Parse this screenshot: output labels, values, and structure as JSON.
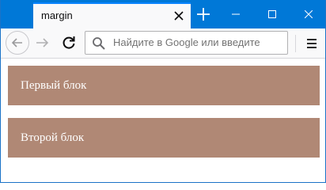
{
  "browser": {
    "tab_title": "margin",
    "url_placeholder": "Найдите в Google или введите",
    "accent_color": "#0078d7",
    "icons": {
      "tab_close": "close-icon",
      "new_tab": "plus-icon",
      "minimize": "minimize-icon",
      "maximize": "maximize-icon",
      "close_window": "close-icon",
      "back": "arrow-left-icon",
      "forward": "arrow-right-icon",
      "reload": "reload-icon",
      "search": "search-icon",
      "menu": "hamburger-icon"
    }
  },
  "page": {
    "block_color": "#b08875",
    "blocks": [
      {
        "label": "Первый блок"
      },
      {
        "label": "Второй блок"
      }
    ]
  }
}
